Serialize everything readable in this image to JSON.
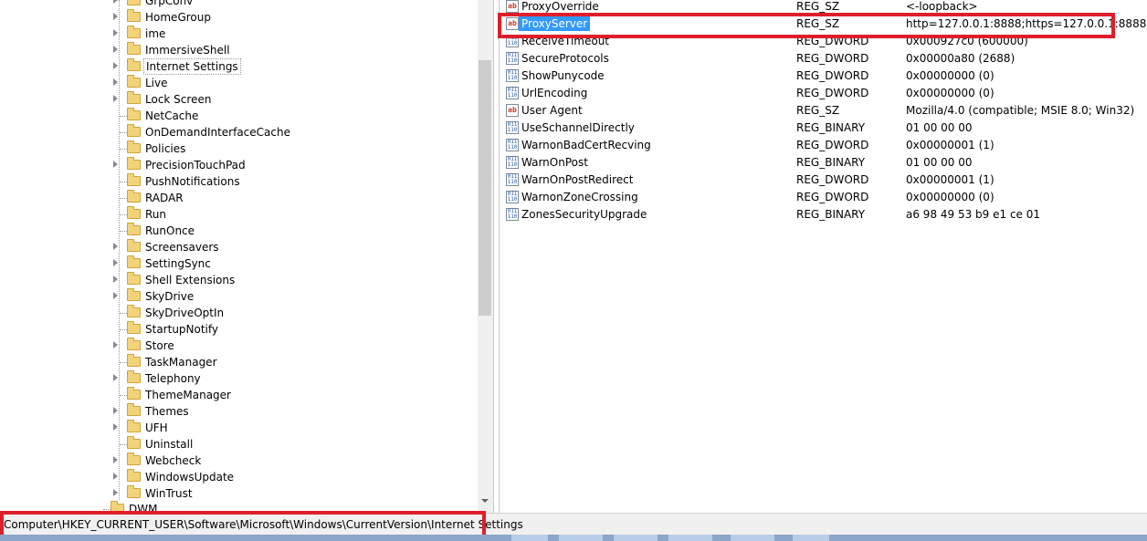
{
  "tree": {
    "items": [
      {
        "label": "GrpConv",
        "has_children": true
      },
      {
        "label": "HomeGroup",
        "has_children": true
      },
      {
        "label": "ime",
        "has_children": true
      },
      {
        "label": "ImmersiveShell",
        "has_children": true
      },
      {
        "label": "Internet Settings",
        "has_children": true,
        "selected": true
      },
      {
        "label": "Live",
        "has_children": true
      },
      {
        "label": "Lock Screen",
        "has_children": true
      },
      {
        "label": "NetCache",
        "has_children": false
      },
      {
        "label": "OnDemandInterfaceCache",
        "has_children": false
      },
      {
        "label": "Policies",
        "has_children": false
      },
      {
        "label": "PrecisionTouchPad",
        "has_children": true
      },
      {
        "label": "PushNotifications",
        "has_children": false
      },
      {
        "label": "RADAR",
        "has_children": false
      },
      {
        "label": "Run",
        "has_children": false
      },
      {
        "label": "RunOnce",
        "has_children": false
      },
      {
        "label": "Screensavers",
        "has_children": true
      },
      {
        "label": "SettingSync",
        "has_children": true
      },
      {
        "label": "Shell Extensions",
        "has_children": true
      },
      {
        "label": "SkyDrive",
        "has_children": true
      },
      {
        "label": "SkyDriveOptIn",
        "has_children": false
      },
      {
        "label": "StartupNotify",
        "has_children": false
      },
      {
        "label": "Store",
        "has_children": true
      },
      {
        "label": "TaskManager",
        "has_children": false
      },
      {
        "label": "Telephony",
        "has_children": true
      },
      {
        "label": "ThemeManager",
        "has_children": false
      },
      {
        "label": "Themes",
        "has_children": true
      },
      {
        "label": "UFH",
        "has_children": true
      },
      {
        "label": "Uninstall",
        "has_children": false
      },
      {
        "label": "Webcheck",
        "has_children": true
      },
      {
        "label": "WindowsUpdate",
        "has_children": true
      },
      {
        "label": "WinTrust",
        "has_children": true
      },
      {
        "label": "DWM",
        "has_children": false
      }
    ]
  },
  "values": [
    {
      "name": "ProxyOverride",
      "type": "REG_SZ",
      "data": "<-loopback>",
      "icon": "string-value-icon"
    },
    {
      "name": "ProxyServer",
      "type": "REG_SZ",
      "data": "http=127.0.0.1:8888;https=127.0.0.1:8888",
      "icon": "string-value-icon",
      "selected": true
    },
    {
      "name": "ReceiveTimeout",
      "type": "REG_DWORD",
      "data": "0x000927c0 (600000)",
      "icon": "binary-value-icon"
    },
    {
      "name": "SecureProtocols",
      "type": "REG_DWORD",
      "data": "0x00000a80 (2688)",
      "icon": "binary-value-icon"
    },
    {
      "name": "ShowPunycode",
      "type": "REG_DWORD",
      "data": "0x00000000 (0)",
      "icon": "binary-value-icon"
    },
    {
      "name": "UrlEncoding",
      "type": "REG_DWORD",
      "data": "0x00000000 (0)",
      "icon": "binary-value-icon"
    },
    {
      "name": "User Agent",
      "type": "REG_SZ",
      "data": "Mozilla/4.0 (compatible; MSIE 8.0; Win32)",
      "icon": "string-value-icon"
    },
    {
      "name": "UseSchannelDirectly",
      "type": "REG_BINARY",
      "data": "01 00 00 00",
      "icon": "binary-value-icon"
    },
    {
      "name": "WarnonBadCertRecving",
      "type": "REG_DWORD",
      "data": "0x00000001 (1)",
      "icon": "binary-value-icon"
    },
    {
      "name": "WarnOnPost",
      "type": "REG_BINARY",
      "data": "01 00 00 00",
      "icon": "binary-value-icon"
    },
    {
      "name": "WarnOnPostRedirect",
      "type": "REG_DWORD",
      "data": "0x00000001 (1)",
      "icon": "binary-value-icon"
    },
    {
      "name": "WarnonZoneCrossing",
      "type": "REG_DWORD",
      "data": "0x00000000 (0)",
      "icon": "binary-value-icon"
    },
    {
      "name": "ZonesSecurityUpgrade",
      "type": "REG_BINARY",
      "data": "a6 98 49 53 b9 e1 ce 01",
      "icon": "binary-value-icon"
    }
  ],
  "status_bar": {
    "path": "Computer\\HKEY_CURRENT_USER\\Software\\Microsoft\\Windows\\CurrentVersion\\Internet Settings"
  },
  "colors": {
    "highlight": "#e01e2a",
    "selection": "#3399ff"
  }
}
